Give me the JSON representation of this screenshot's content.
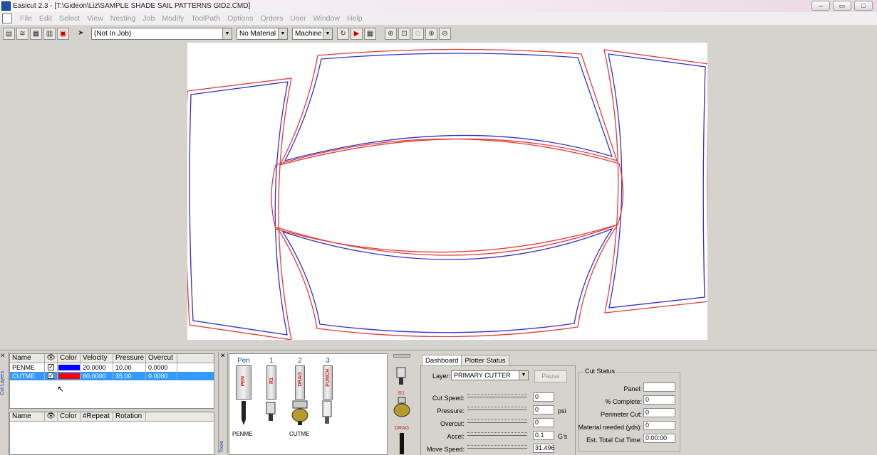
{
  "title": "Easicut 2.3 - [T:\\Gideon\\Liz\\SAMPLE SHADE SAIL PATTERNS GID2.CMD]",
  "menu": [
    "File",
    "Edit",
    "Select",
    "View",
    "Nesting",
    "Job",
    "Modify",
    "ToolPath",
    "Options",
    "Orders",
    "User",
    "Window",
    "Help"
  ],
  "toolbar": {
    "job_combo": "(Not In Job)",
    "material_combo": "No Material",
    "machine_combo": "Machine"
  },
  "layers_grid": {
    "headers": [
      "Name",
      "Color",
      "Velocity",
      "Pressure",
      "Overcut"
    ],
    "rows": [
      {
        "name": "PENME",
        "color": "#0000ff",
        "velocity": "20.0000",
        "pressure": "10.00",
        "overcut": "0.0000"
      },
      {
        "name": "CUTME",
        "color": "#ff0000",
        "velocity": "60.0000",
        "pressure": "35.00",
        "overcut": "0.0000"
      }
    ],
    "side_label": "Cut Layers"
  },
  "repeat_grid": {
    "headers": [
      "Name",
      "Color",
      "#Repeat",
      "Rotation"
    ]
  },
  "tools": {
    "headers": [
      "Pen",
      "1",
      "2",
      "3"
    ],
    "tool_texts": [
      "PEN",
      "R1",
      "DRAG",
      "PUNCH"
    ],
    "assigned": [
      "PENME",
      "CUTME"
    ],
    "side_label": "Tools"
  },
  "head_tools": [
    "R1",
    "DRAG"
  ],
  "dashboard": {
    "tabs": [
      "Dashboard",
      "Plotter Status"
    ],
    "layer_label": "Layer:",
    "layer_value": "PRIMARY CUTTER",
    "pause": "Pause",
    "cut_speed_label": "Cut Speed:",
    "cut_speed": "0",
    "pressure_label": "Pressure:",
    "pressure": "0",
    "pressure_unit": "psi",
    "overcut_label": "Overcut:",
    "overcut": "0",
    "accel_label": "Accel:",
    "accel": "0.1",
    "accel_unit": "G's",
    "move_speed_label": "Move Speed:",
    "move_speed": "31.496"
  },
  "cut_status": {
    "title": "Cut Status",
    "panel_label": "Panel:",
    "panel": "",
    "complete_label": "% Complete:",
    "complete": "0",
    "perimeter_label": "Perimeter Cut:",
    "perimeter": "0",
    "material_label": "Material needed (yds):",
    "material": "0",
    "time_label": "Est. Total Cut Time:",
    "time": "0:00:00"
  }
}
